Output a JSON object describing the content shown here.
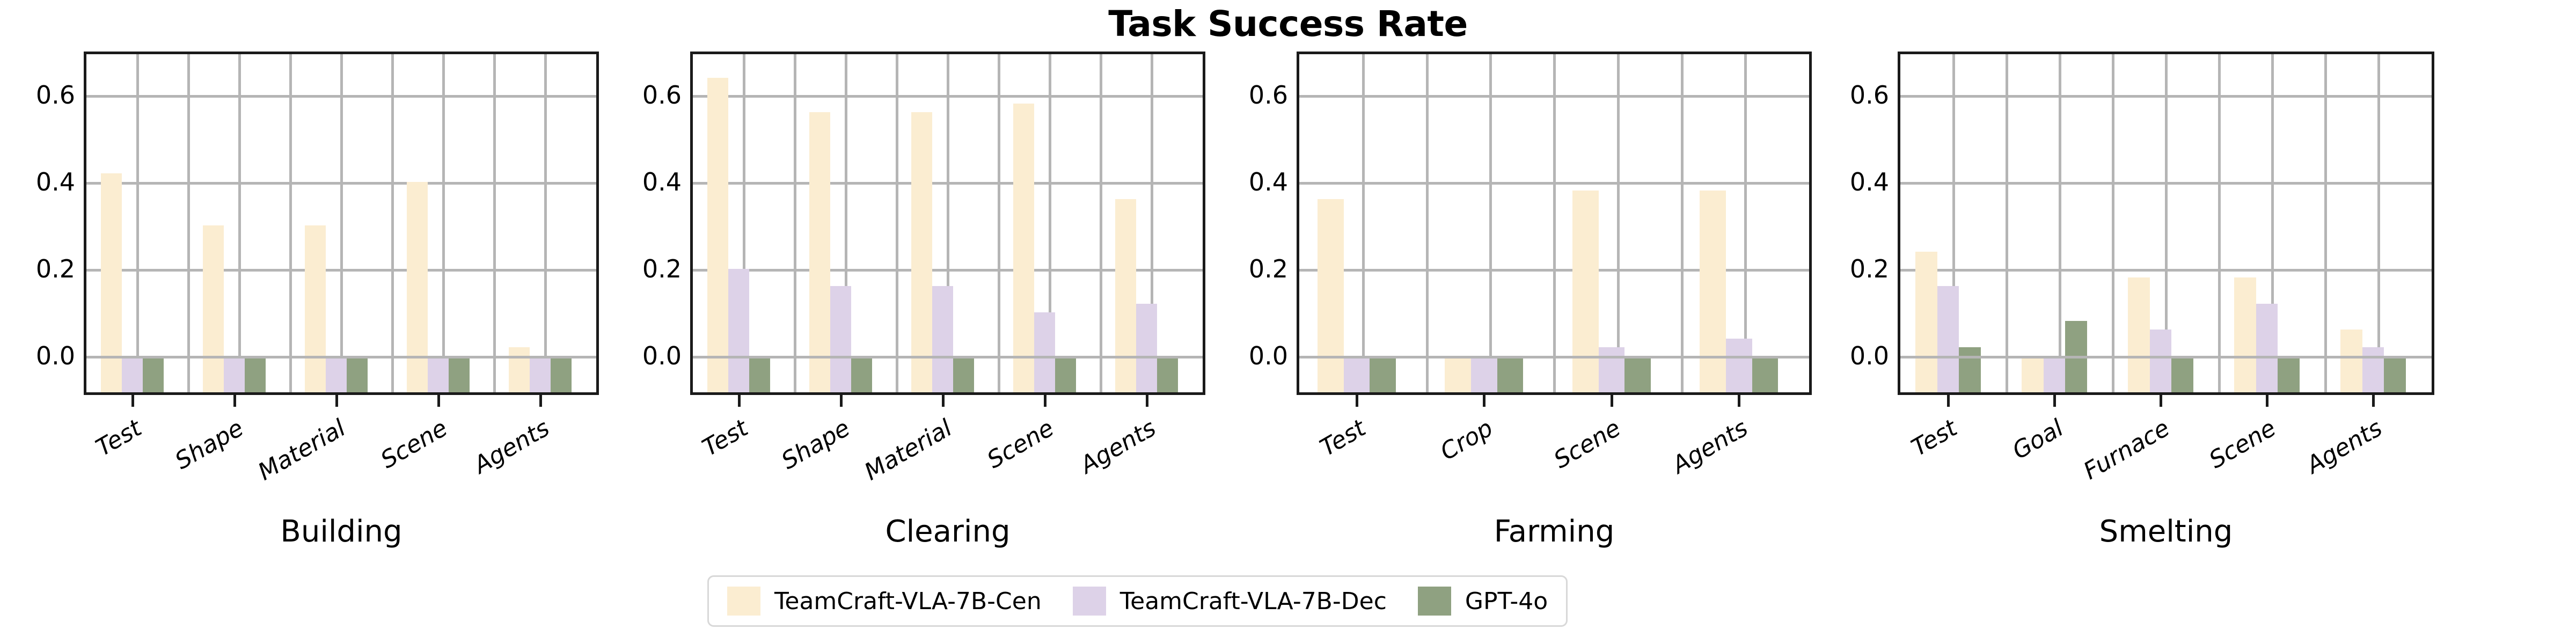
{
  "chart_data": {
    "type": "bar",
    "title": "Task Success Rate",
    "xlabel": "",
    "ylabel": "",
    "ylim": [
      -0.09,
      0.7
    ],
    "yticks": [
      0.0,
      0.2,
      0.4,
      0.6
    ],
    "ytick_labels": [
      "0.0",
      "0.2",
      "0.4",
      "0.6"
    ],
    "grid": true,
    "legend_position": "bottom-center",
    "series_names": [
      "TeamCraft-VLA-7B-Cen",
      "TeamCraft-VLA-7B-Dec",
      "GPT-4o"
    ],
    "series_colors": [
      "#FBEDD1",
      "#DDD2E8",
      "#8FA181"
    ],
    "panels": [
      {
        "name": "Building",
        "categories": [
          "Test",
          "Shape",
          "Material",
          "Scene",
          "Agents"
        ],
        "series": [
          {
            "name": "TeamCraft-VLA-7B-Cen",
            "values": [
              0.42,
              0.3,
              0.3,
              0.4,
              0.02
            ]
          },
          {
            "name": "TeamCraft-VLA-7B-Dec",
            "values": [
              0.0,
              0.0,
              0.0,
              0.0,
              0.0
            ]
          },
          {
            "name": "GPT-4o",
            "values": [
              0.0,
              0.0,
              0.0,
              0.0,
              0.0
            ]
          }
        ]
      },
      {
        "name": "Clearing",
        "categories": [
          "Test",
          "Shape",
          "Material",
          "Scene",
          "Agents"
        ],
        "series": [
          {
            "name": "TeamCraft-VLA-7B-Cen",
            "values": [
              0.64,
              0.56,
              0.56,
              0.58,
              0.36
            ]
          },
          {
            "name": "TeamCraft-VLA-7B-Dec",
            "values": [
              0.2,
              0.16,
              0.16,
              0.1,
              0.12
            ]
          },
          {
            "name": "GPT-4o",
            "values": [
              0.0,
              0.0,
              0.0,
              0.0,
              0.0
            ]
          }
        ]
      },
      {
        "name": "Farming",
        "categories": [
          "Test",
          "Crop",
          "Scene",
          "Agents"
        ],
        "series": [
          {
            "name": "TeamCraft-VLA-7B-Cen",
            "values": [
              0.36,
              0.0,
              0.38,
              0.38
            ]
          },
          {
            "name": "TeamCraft-VLA-7B-Dec",
            "values": [
              0.0,
              0.0,
              0.02,
              0.04
            ]
          },
          {
            "name": "GPT-4o",
            "values": [
              0.0,
              0.0,
              0.0,
              0.0
            ]
          }
        ]
      },
      {
        "name": "Smelting",
        "categories": [
          "Test",
          "Goal",
          "Furnace",
          "Scene",
          "Agents"
        ],
        "series": [
          {
            "name": "TeamCraft-VLA-7B-Cen",
            "values": [
              0.24,
              0.0,
              0.18,
              0.18,
              0.06
            ]
          },
          {
            "name": "TeamCraft-VLA-7B-Dec",
            "values": [
              0.16,
              0.0,
              0.06,
              0.12,
              0.02
            ]
          },
          {
            "name": "GPT-4o",
            "values": [
              0.02,
              0.08,
              0.0,
              0.0,
              0.0
            ]
          }
        ]
      }
    ]
  },
  "legend": {
    "entries": [
      {
        "label": "TeamCraft-VLA-7B-Cen",
        "color": "#FBEDD1"
      },
      {
        "label": "TeamCraft-VLA-7B-Dec",
        "color": "#DDD2E8"
      },
      {
        "label": "GPT-4o",
        "color": "#8FA181"
      }
    ]
  }
}
